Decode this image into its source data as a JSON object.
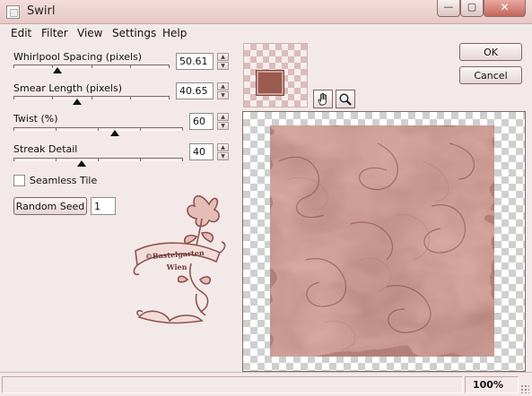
{
  "window": {
    "title": "Swirl",
    "minimize_glyph": "—",
    "maximize_glyph": "▢",
    "close_glyph": "✕"
  },
  "menu": {
    "items": [
      "Edit",
      "Filter",
      "View",
      "Settings",
      "Help"
    ]
  },
  "params": {
    "whirlpool": {
      "label": "Whirlpool Spacing (pixels)",
      "value": "50.61",
      "slider_level": 0.28
    },
    "smear": {
      "label": "Smear Length (pixels)",
      "value": "40.65",
      "slider_level": 0.41
    },
    "twist": {
      "label": "Twist (%)",
      "value": "60",
      "slider_level": 0.6
    },
    "streak": {
      "label": "Streak Detail",
      "value": "40",
      "slider_level": 0.4
    }
  },
  "seamless": {
    "label": "Seamless Tile",
    "checked": false
  },
  "random_seed": {
    "button_label": "Random Seed",
    "value": "1"
  },
  "buttons": {
    "ok": "OK",
    "cancel": "Cancel"
  },
  "tools": {
    "hand": "hand-icon",
    "zoom": "magnifier-icon"
  },
  "watermark": {
    "line1": "©Bastelgarten",
    "line2": "Wien"
  },
  "status": {
    "zoom": "100%"
  },
  "colors": {
    "window_bg": "#f3e9e8",
    "swirl_base": "#9d5f56",
    "swirl_dark": "#7e4138",
    "swirl_light": "#b87b70"
  }
}
